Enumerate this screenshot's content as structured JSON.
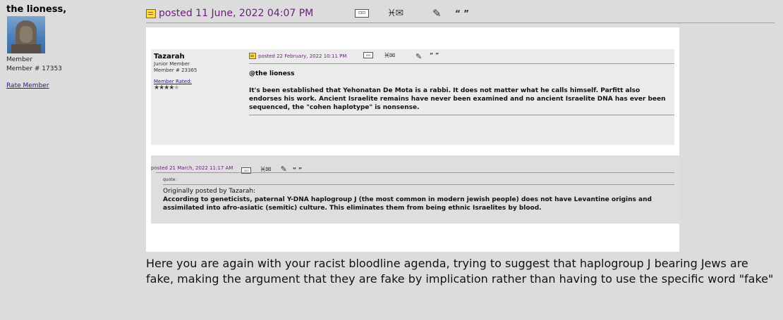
{
  "author": {
    "name": "the lioness,",
    "rank": "Member",
    "member_number": "Member # 17353",
    "rate_link": "Rate Member"
  },
  "post": {
    "posted": "posted 11 June, 2022 04:07 PM",
    "reply_text": "Here you are again with your racist bloodline agenda, trying to suggest that haplogroup J bearing Jews are fake, making the argument that they are fake by implication rather than having to use the specific word \"fake\""
  },
  "quoted_post": {
    "author": "Tazarah",
    "rank": "Junior Member",
    "member_number": "Member # 23365",
    "rated_label": "Member Rated:",
    "stars": "★★★★",
    "stars_dim": "★",
    "posted": "posted 22 February, 2022 10:11 PM",
    "mention": "@the lioness",
    "body": "It's been established that Yehonatan De Mota is a rabbi. It does not matter what he calls himself. Parfitt also endorses his work. Ancient Israelite remains have never been examined and no ancient Israelite DNA has ever been sequenced, the \"cohen haplotype\" is nonsense."
  },
  "nested_quote": {
    "posted": "posted 21 March, 2022 11:17 AM",
    "label": "quote:",
    "origin": "Originally posted by Tazarah:",
    "text": "According to geneticists, paternal Y-DNA haplogroup J (the most common in modern jewish people) does not have Levantine origins and assimilated into afro-asiatic (semitic) culture. This eliminates them from being ethnic Israelites by blood."
  },
  "icons": {
    "profile": "profile-icon",
    "email": "email-icon",
    "edit": "edit-icon",
    "quote": "quote-icon",
    "profile_glyph": "⊡⊡",
    "email_glyph": "♓✉",
    "edit_glyph": "✎",
    "quote_glyph": "“ ”"
  }
}
